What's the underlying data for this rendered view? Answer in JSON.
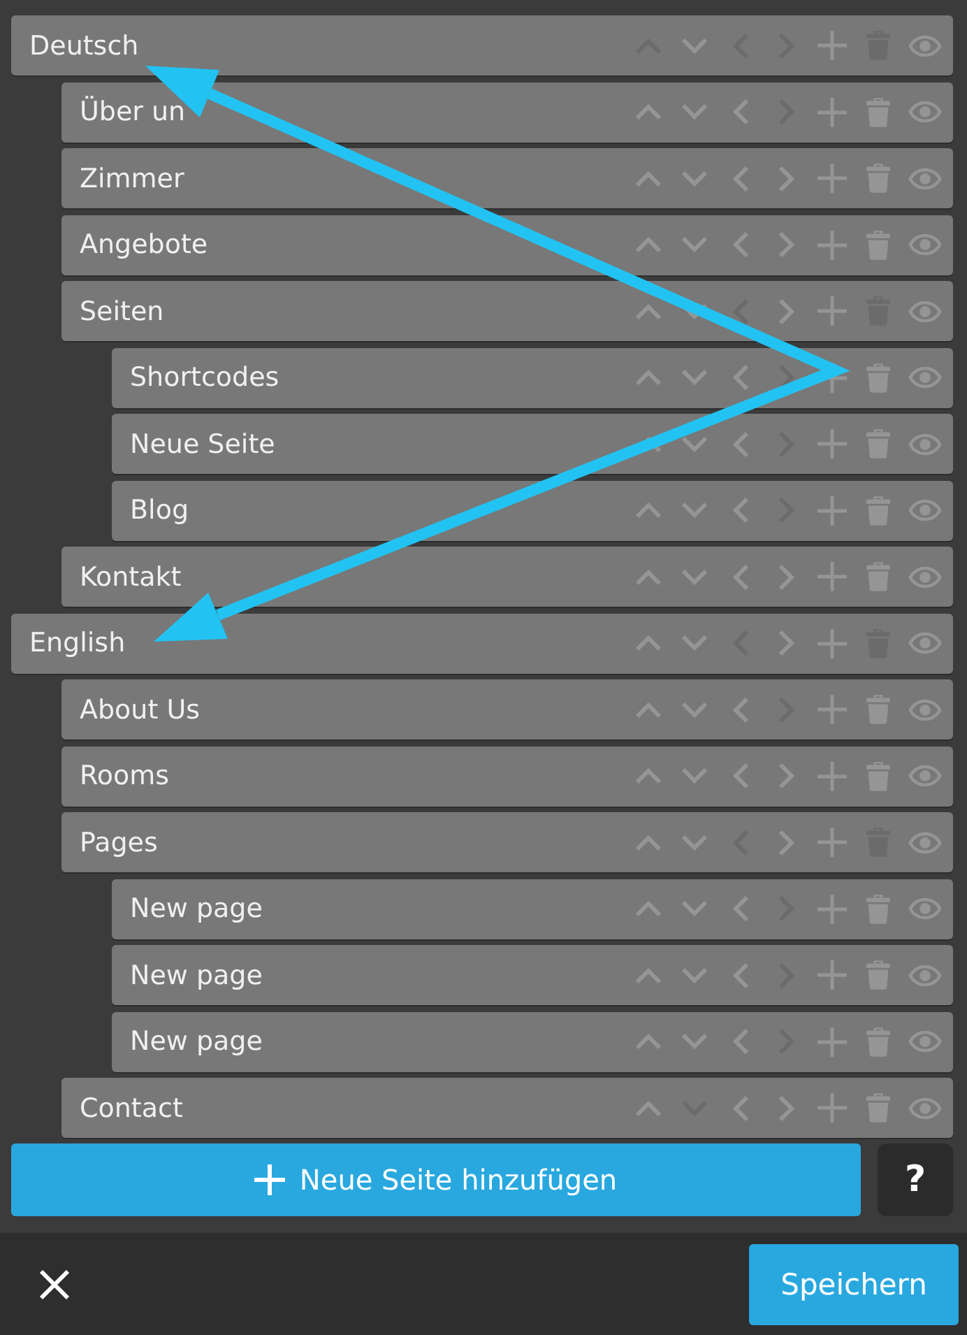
{
  "pages": [
    {
      "label": "Deutsch",
      "actions": [
        {
          "kind": "up",
          "disabled": true
        },
        {
          "kind": "down",
          "disabled": false
        },
        {
          "kind": "left",
          "disabled": true
        },
        {
          "kind": "right",
          "disabled": true
        },
        {
          "kind": "add",
          "disabled": false
        },
        {
          "kind": "delete",
          "disabled": true
        },
        {
          "kind": "visibility",
          "disabled": false
        }
      ],
      "children": [
        {
          "label": "Über un",
          "actions": [
            {
              "kind": "up",
              "disabled": false
            },
            {
              "kind": "down",
              "disabled": false
            },
            {
              "kind": "left",
              "disabled": false
            },
            {
              "kind": "right",
              "disabled": true
            },
            {
              "kind": "add",
              "disabled": false
            },
            {
              "kind": "delete",
              "disabled": false
            },
            {
              "kind": "visibility",
              "disabled": false
            }
          ]
        },
        {
          "label": "Zimmer",
          "actions": [
            {
              "kind": "up",
              "disabled": false
            },
            {
              "kind": "down",
              "disabled": false
            },
            {
              "kind": "left",
              "disabled": false
            },
            {
              "kind": "right",
              "disabled": false
            },
            {
              "kind": "add",
              "disabled": false
            },
            {
              "kind": "delete",
              "disabled": false
            },
            {
              "kind": "visibility",
              "disabled": false
            }
          ]
        },
        {
          "label": "Angebote",
          "actions": [
            {
              "kind": "up",
              "disabled": false
            },
            {
              "kind": "down",
              "disabled": false
            },
            {
              "kind": "left",
              "disabled": false
            },
            {
              "kind": "right",
              "disabled": false
            },
            {
              "kind": "add",
              "disabled": false
            },
            {
              "kind": "delete",
              "disabled": false
            },
            {
              "kind": "visibility",
              "disabled": false
            }
          ]
        },
        {
          "label": "Seiten",
          "actions": [
            {
              "kind": "up",
              "disabled": false
            },
            {
              "kind": "down",
              "disabled": false
            },
            {
              "kind": "left",
              "disabled": true
            },
            {
              "kind": "right",
              "disabled": false
            },
            {
              "kind": "add",
              "disabled": false
            },
            {
              "kind": "delete",
              "disabled": true
            },
            {
              "kind": "visibility",
              "disabled": false
            }
          ],
          "children": [
            {
              "label": "Shortcodes",
              "actions": [
                {
                  "kind": "up",
                  "disabled": false
                },
                {
                  "kind": "down",
                  "disabled": false
                },
                {
                  "kind": "left",
                  "disabled": false
                },
                {
                  "kind": "right",
                  "disabled": true
                },
                {
                  "kind": "add",
                  "disabled": false
                },
                {
                  "kind": "delete",
                  "disabled": false
                },
                {
                  "kind": "visibility",
                  "disabled": false
                }
              ]
            },
            {
              "label": "Neue Seite",
              "actions": [
                {
                  "kind": "up",
                  "disabled": false
                },
                {
                  "kind": "down",
                  "disabled": false
                },
                {
                  "kind": "left",
                  "disabled": false
                },
                {
                  "kind": "right",
                  "disabled": true
                },
                {
                  "kind": "add",
                  "disabled": false
                },
                {
                  "kind": "delete",
                  "disabled": false
                },
                {
                  "kind": "visibility",
                  "disabled": false
                }
              ]
            },
            {
              "label": "Blog",
              "actions": [
                {
                  "kind": "up",
                  "disabled": false
                },
                {
                  "kind": "down",
                  "disabled": false
                },
                {
                  "kind": "left",
                  "disabled": false
                },
                {
                  "kind": "right",
                  "disabled": true
                },
                {
                  "kind": "add",
                  "disabled": false
                },
                {
                  "kind": "delete",
                  "disabled": false
                },
                {
                  "kind": "visibility",
                  "disabled": false
                }
              ]
            }
          ]
        },
        {
          "label": "Kontakt",
          "actions": [
            {
              "kind": "up",
              "disabled": false
            },
            {
              "kind": "down",
              "disabled": false
            },
            {
              "kind": "left",
              "disabled": false
            },
            {
              "kind": "right",
              "disabled": false
            },
            {
              "kind": "add",
              "disabled": false
            },
            {
              "kind": "delete",
              "disabled": false
            },
            {
              "kind": "visibility",
              "disabled": false
            }
          ]
        }
      ]
    },
    {
      "label": "English",
      "actions": [
        {
          "kind": "up",
          "disabled": false
        },
        {
          "kind": "down",
          "disabled": false
        },
        {
          "kind": "left",
          "disabled": true
        },
        {
          "kind": "right",
          "disabled": false
        },
        {
          "kind": "add",
          "disabled": false
        },
        {
          "kind": "delete",
          "disabled": true
        },
        {
          "kind": "visibility",
          "disabled": false
        }
      ],
      "children": [
        {
          "label": "About Us",
          "actions": [
            {
              "kind": "up",
              "disabled": false
            },
            {
              "kind": "down",
              "disabled": false
            },
            {
              "kind": "left",
              "disabled": false
            },
            {
              "kind": "right",
              "disabled": true
            },
            {
              "kind": "add",
              "disabled": false
            },
            {
              "kind": "delete",
              "disabled": false
            },
            {
              "kind": "visibility",
              "disabled": false
            }
          ]
        },
        {
          "label": "Rooms",
          "actions": [
            {
              "kind": "up",
              "disabled": false
            },
            {
              "kind": "down",
              "disabled": false
            },
            {
              "kind": "left",
              "disabled": false
            },
            {
              "kind": "right",
              "disabled": false
            },
            {
              "kind": "add",
              "disabled": false
            },
            {
              "kind": "delete",
              "disabled": false
            },
            {
              "kind": "visibility",
              "disabled": false
            }
          ]
        },
        {
          "label": "Pages",
          "actions": [
            {
              "kind": "up",
              "disabled": false
            },
            {
              "kind": "down",
              "disabled": false
            },
            {
              "kind": "left",
              "disabled": true
            },
            {
              "kind": "right",
              "disabled": false
            },
            {
              "kind": "add",
              "disabled": false
            },
            {
              "kind": "delete",
              "disabled": true
            },
            {
              "kind": "visibility",
              "disabled": false
            }
          ],
          "children": [
            {
              "label": "New page",
              "actions": [
                {
                  "kind": "up",
                  "disabled": false
                },
                {
                  "kind": "down",
                  "disabled": false
                },
                {
                  "kind": "left",
                  "disabled": false
                },
                {
                  "kind": "right",
                  "disabled": true
                },
                {
                  "kind": "add",
                  "disabled": false
                },
                {
                  "kind": "delete",
                  "disabled": false
                },
                {
                  "kind": "visibility",
                  "disabled": false
                }
              ]
            },
            {
              "label": "New page",
              "actions": [
                {
                  "kind": "up",
                  "disabled": false
                },
                {
                  "kind": "down",
                  "disabled": false
                },
                {
                  "kind": "left",
                  "disabled": false
                },
                {
                  "kind": "right",
                  "disabled": true
                },
                {
                  "kind": "add",
                  "disabled": false
                },
                {
                  "kind": "delete",
                  "disabled": false
                },
                {
                  "kind": "visibility",
                  "disabled": false
                }
              ]
            },
            {
              "label": "New page",
              "actions": [
                {
                  "kind": "up",
                  "disabled": false
                },
                {
                  "kind": "down",
                  "disabled": false
                },
                {
                  "kind": "left",
                  "disabled": false
                },
                {
                  "kind": "right",
                  "disabled": true
                },
                {
                  "kind": "add",
                  "disabled": false
                },
                {
                  "kind": "delete",
                  "disabled": false
                },
                {
                  "kind": "visibility",
                  "disabled": false
                }
              ]
            }
          ]
        },
        {
          "label": "Contact",
          "actions": [
            {
              "kind": "up",
              "disabled": false
            },
            {
              "kind": "down",
              "disabled": true
            },
            {
              "kind": "left",
              "disabled": false
            },
            {
              "kind": "right",
              "disabled": false
            },
            {
              "kind": "add",
              "disabled": false
            },
            {
              "kind": "delete",
              "disabled": false
            },
            {
              "kind": "visibility",
              "disabled": false
            }
          ]
        }
      ]
    }
  ],
  "add_button": {
    "label": "Neue Seite hinzufügen"
  },
  "help_button": {
    "label": "?"
  },
  "save_button": {
    "label": "Speichern"
  }
}
